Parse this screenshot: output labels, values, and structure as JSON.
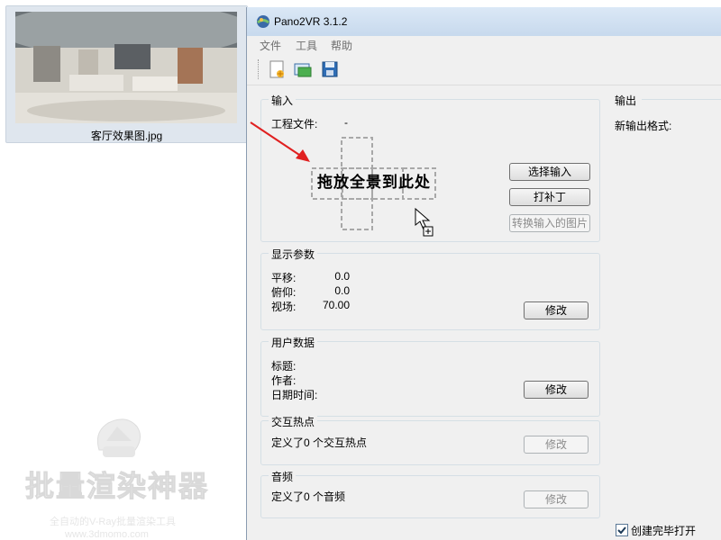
{
  "explorer": {
    "thumbnail_caption": "客厅效果图.jpg",
    "watermark": {
      "title": "批量渲染神器",
      "tagline": "全自动的V-Ray批量渲染工具",
      "url": "www.3dmomo.com"
    }
  },
  "window": {
    "title": "Pano2VR 3.1.2",
    "menu": [
      "文件",
      "工具",
      "帮助"
    ],
    "toolbar_icons": [
      "new-project-icon",
      "open-project-icon",
      "save-project-icon"
    ]
  },
  "input": {
    "title": "输入",
    "project_file_label": "工程文件:",
    "project_file_value": "-",
    "drop_hint": "拖放全景到此处",
    "select_input": "选择输入",
    "patch": "打补丁",
    "convert_input": "转换输入的图片"
  },
  "display": {
    "title": "显示参数",
    "pan_label": "平移:",
    "pan_value": "0.0",
    "tilt_label": "俯仰:",
    "tilt_value": "0.0",
    "fov_label": "视场:",
    "fov_value": "70.00",
    "modify": "修改"
  },
  "userdata": {
    "title": "用户数据",
    "title_label": "标题:",
    "author_label": "作者:",
    "datetime_label": "日期时间:",
    "modify": "修改"
  },
  "hotspots": {
    "title": "交互热点",
    "summary": "定义了0 个交互热点",
    "modify": "修改"
  },
  "audio": {
    "title": "音频",
    "summary": "定义了0 个音频",
    "modify": "修改"
  },
  "output": {
    "title": "输出",
    "new_format_label": "新输出格式:",
    "open_when_done_label": "创建完毕打开",
    "open_when_done_checked": true
  }
}
